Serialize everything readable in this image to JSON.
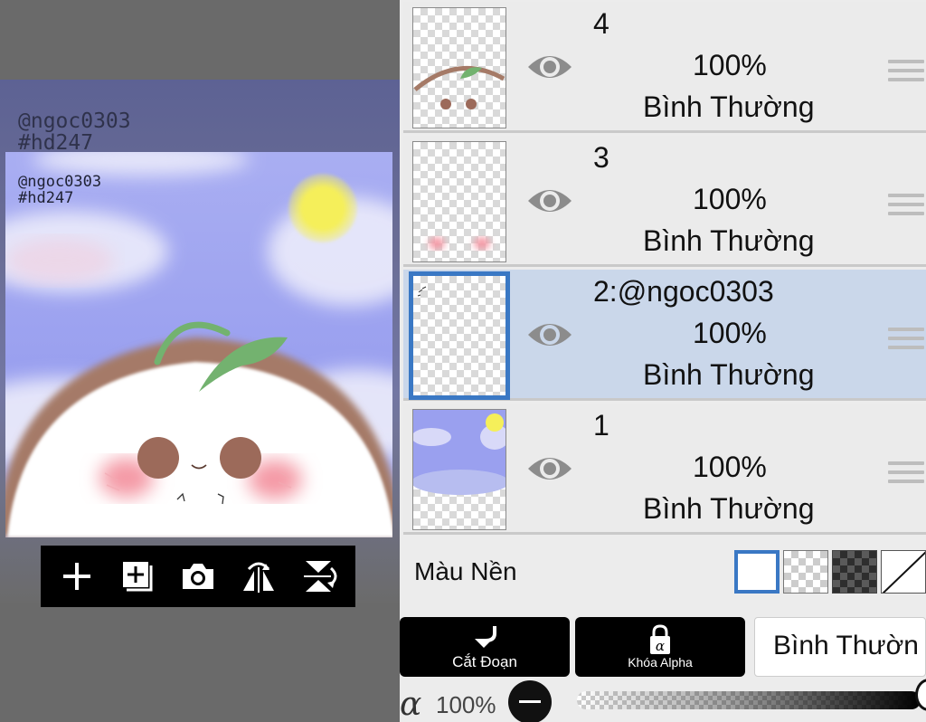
{
  "canvas": {
    "watermark_back": [
      "@ngoc0303",
      "#hd247"
    ],
    "watermark_front": [
      "@ngoc0303",
      "#hd247"
    ]
  },
  "toolbar": {
    "icons": [
      "add-layer-icon",
      "duplicate-layer-icon",
      "camera-icon",
      "flip-horizontal-icon",
      "flip-vertical-icon"
    ]
  },
  "layers": [
    {
      "name": "4",
      "opacity": "100%",
      "blend": "Bình Thường",
      "visible": true,
      "selected": false
    },
    {
      "name": "3",
      "opacity": "100%",
      "blend": "Bình Thường",
      "visible": true,
      "selected": false
    },
    {
      "name": "2:@ngoc0303",
      "opacity": "100%",
      "blend": "Bình Thường",
      "visible": true,
      "selected": true
    },
    {
      "name": "1",
      "opacity": "100%",
      "blend": "Bình Thường",
      "visible": true,
      "selected": false
    }
  ],
  "background": {
    "label": "Màu Nền",
    "options": [
      "white",
      "light-checker",
      "dark-checker",
      "none"
    ],
    "selected": "white"
  },
  "actions": {
    "clip_label": "Cắt Đoạn",
    "alpha_lock_label": "Khóa Alpha",
    "blend_mode": "Bình Thườn"
  },
  "alpha": {
    "symbol": "α",
    "value": "100%",
    "level": 1.0
  },
  "colors": {
    "accent": "#3a78c4",
    "selected_row": "#cad7ea",
    "panel": "#ececec",
    "eye": "#8c8c8c"
  }
}
